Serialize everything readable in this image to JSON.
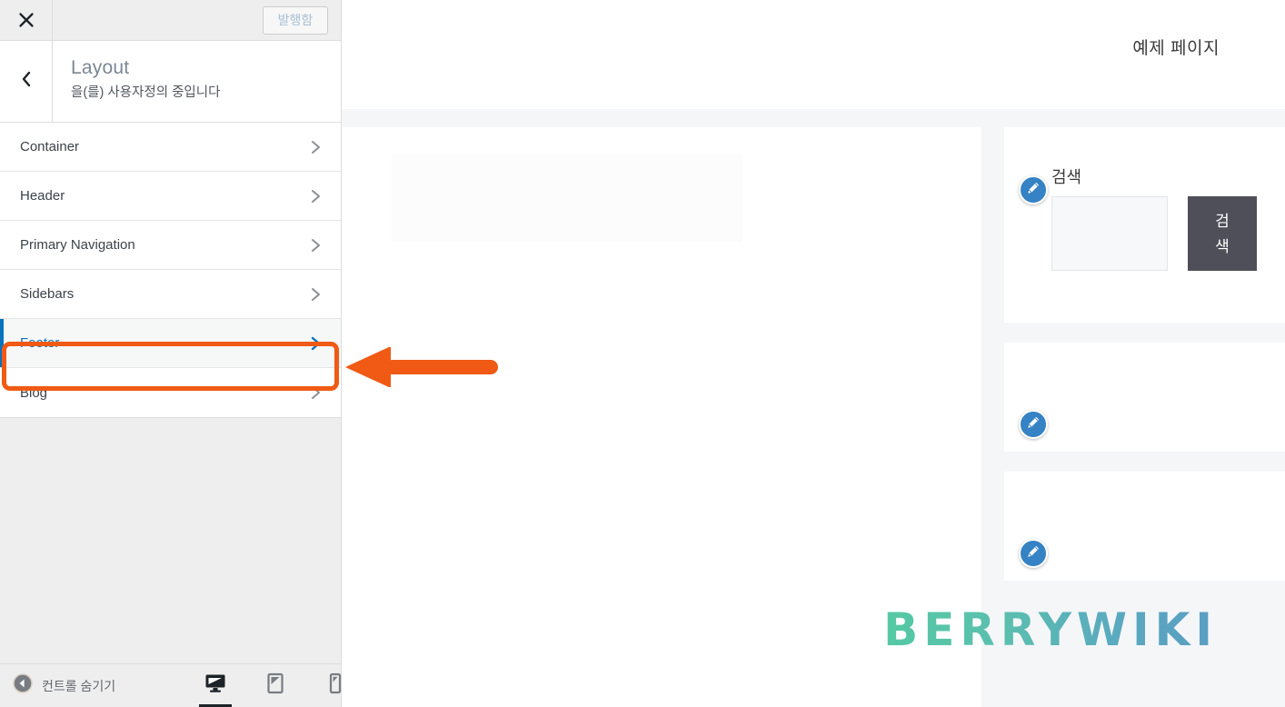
{
  "customizer": {
    "topbar": {
      "close_label": "close-icon",
      "publish_label": "발행함"
    },
    "header": {
      "back_label": "back-icon",
      "title": "Layout",
      "subtitle": "을(를) 사용자정의 중입니다"
    },
    "panels": [
      {
        "label": "Container",
        "active": false
      },
      {
        "label": "Header",
        "active": false
      },
      {
        "label": "Primary Navigation",
        "active": false
      },
      {
        "label": "Sidebars",
        "active": false
      },
      {
        "label": "Footer",
        "active": true
      },
      {
        "label": "Blog",
        "active": false
      }
    ],
    "footer_bar": {
      "collapse_label": "컨트롤 숨기기",
      "devices": [
        {
          "name": "desktop",
          "active": true
        },
        {
          "name": "tablet",
          "active": false
        },
        {
          "name": "mobile",
          "active": false
        }
      ]
    }
  },
  "preview": {
    "site_title": "예제 페이지",
    "widgets": {
      "search": {
        "title": "검색",
        "input_value": "",
        "input_placeholder": "",
        "button_label": "검 색"
      }
    },
    "watermark": "BERRYWIKI"
  },
  "annotations": {
    "highlight_target": "Footer",
    "highlight_color": "#f05a14",
    "arrow_color": "#f05a14"
  },
  "colors": {
    "accent_blue": "#0b72bf",
    "annotation_orange": "#f05a14",
    "edit_pin_blue": "#3582c4",
    "search_button_dark": "#4f4f5a",
    "panel_bg": "#eeeeee",
    "preview_bg": "#f5f6f8"
  }
}
